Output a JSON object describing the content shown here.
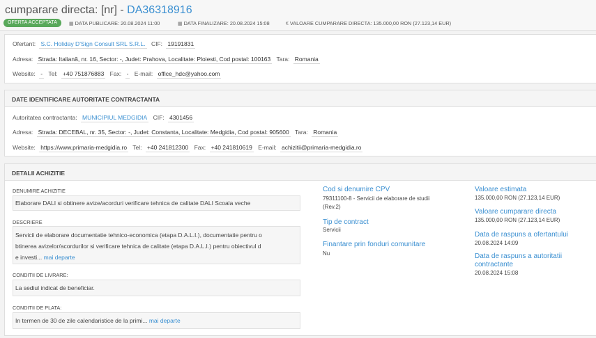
{
  "header": {
    "title_prefix": "cumparare directa: [nr] - ",
    "title_code": "DA36318916",
    "badge": "OFERTA ACCEPTATA",
    "data_publicare_label": "DATA PUBLICARE:",
    "data_publicare": "20.08.2024 11:00",
    "data_finalizare_label": "DATA FINALIZARE:",
    "data_finalizare": "20.08.2024 15:08",
    "valoare_label": "VALOARE CUMPARARE DIRECTA:",
    "valoare": "135.000,00",
    "valoare_ron": "RON",
    "valoare_eur": "(27.123,14 EUR)",
    "icons": {
      "calendar": "calendar-icon",
      "euro": "euro-icon"
    }
  },
  "ofertant": {
    "label": "Ofertant:",
    "value": "S.C. Holiday D'Sign Consult SRL S.R.L.",
    "cif_label": "CIF:",
    "cif": "19191831",
    "adresa_label": "Adresa:",
    "adresa": "Strada: Italiană, nr. 16, Sector: -, Judet: Prahova, Localitate: Ploiesti, Cod postal: 100163",
    "tara_label": "Tara:",
    "tara": "Romania",
    "website_label": "Website:",
    "website": "-",
    "tel_label": "Tel:",
    "tel": "+40 751876883",
    "fax_label": "Fax:",
    "fax": "-",
    "email_label": "E-mail:",
    "email": "office_hdc@yahoo.com"
  },
  "autoritate": {
    "section_title": "DATE IDENTIFICARE AUTORITATE CONTRACTANTA",
    "label": "Autoritatea contractanta:",
    "value": "MUNICIPIUL MEDGIDIA",
    "cif_label": "CIF:",
    "cif": "4301456",
    "adresa_label": "Adresa:",
    "adresa": "Strada: DECEBAL, nr. 35, Sector: -, Judet: Constanta, Localitate: Medgidia, Cod postal: 905600",
    "tara_label": "Tara:",
    "tara": "Romania",
    "website_label": "Website:",
    "website": "https://www.primaria-medgidia.ro",
    "tel_label": "Tel:",
    "tel": "+40 241812300",
    "fax_label": "Fax:",
    "fax": "+40 241810619",
    "email_label": "E-mail:",
    "email": "achizitii@primaria-medgidia.ro"
  },
  "detalii": {
    "section_title": "DETALII ACHIZITIE",
    "denumire_label": "DENUMIRE ACHIZITIE",
    "denumire": "Elaborare DALI si obtinere avize/acorduri verificare tehnica de calitate DALI Scoala veche",
    "descriere_label": "DESCRIERE",
    "descriere_line1": "Servicii de elaborare documentatie tehnico-economica (etapa D.A.L.I.), documentatie pentru o",
    "descriere_line2": "btinerea avizelor/acordurilor si verificare tehnica de calitate (etapa D.A.L.I.) pentru obiectivul d",
    "descriere_line3": "e investi...",
    "more": "mai departe",
    "livrare_label": "CONDITII DE LIVRARE:",
    "livrare": "La sediul indicat de beneficiar.",
    "plata_label": "CONDITII DE PLATA:",
    "plata": "In termen de 30 de zile calendaristice de la primi...",
    "cpv_label": "Cod si denumire CPV",
    "cpv_line1": "79311100-8 - Servicii de elaborare de studii",
    "cpv_line2": "(Rev.2)",
    "tip_label": "Tip de contract",
    "tip": "Servicii",
    "fonduri_label": "Finantare prin fonduri comunitare",
    "fonduri": "Nu",
    "val_est_label": "Valoare estimata",
    "val_est": "135.000,00  RON (27.123,14 EUR)",
    "val_cd_label": "Valoare cumparare directa",
    "val_cd": "135.000,00  RON (27.123,14 EUR)",
    "raspuns_of_label": "Data de raspuns a ofertantului",
    "raspuns_of": "20.08.2024 14:09",
    "raspuns_ac_label_1": "Data de raspuns a autoritatii",
    "raspuns_ac_label_2": "contractante",
    "raspuns_ac": "20.08.2024 15:08"
  }
}
